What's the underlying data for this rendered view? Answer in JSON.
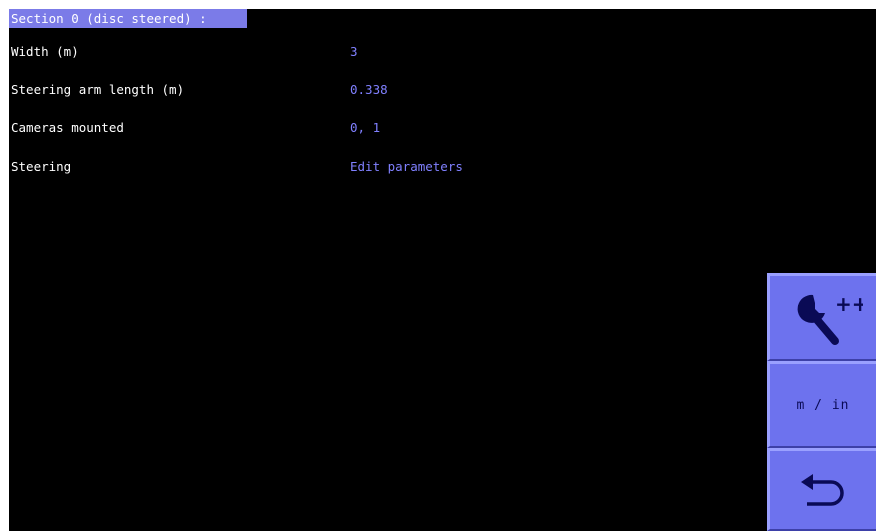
{
  "header": {
    "title": "Section 0 (disc steered) :"
  },
  "rows": [
    {
      "label": "Width (m)",
      "value": "3"
    },
    {
      "label": "Steering arm length (m)",
      "value": "0.338"
    },
    {
      "label": "Cameras mounted",
      "value": "0, 1"
    },
    {
      "label": "Steering",
      "value": "Edit parameters"
    }
  ],
  "sidebar": {
    "advanced_icon": "wrench-plus-plus-icon",
    "advanced_label": "++",
    "units_label": "m / in",
    "back_icon": "return-arrow-icon"
  },
  "colors": {
    "background": "#000000",
    "title_bg": "#7b7be8",
    "label": "#ffffff",
    "value": "#8080ff",
    "button": "#6d72ee",
    "button_text": "#0a0a55"
  }
}
